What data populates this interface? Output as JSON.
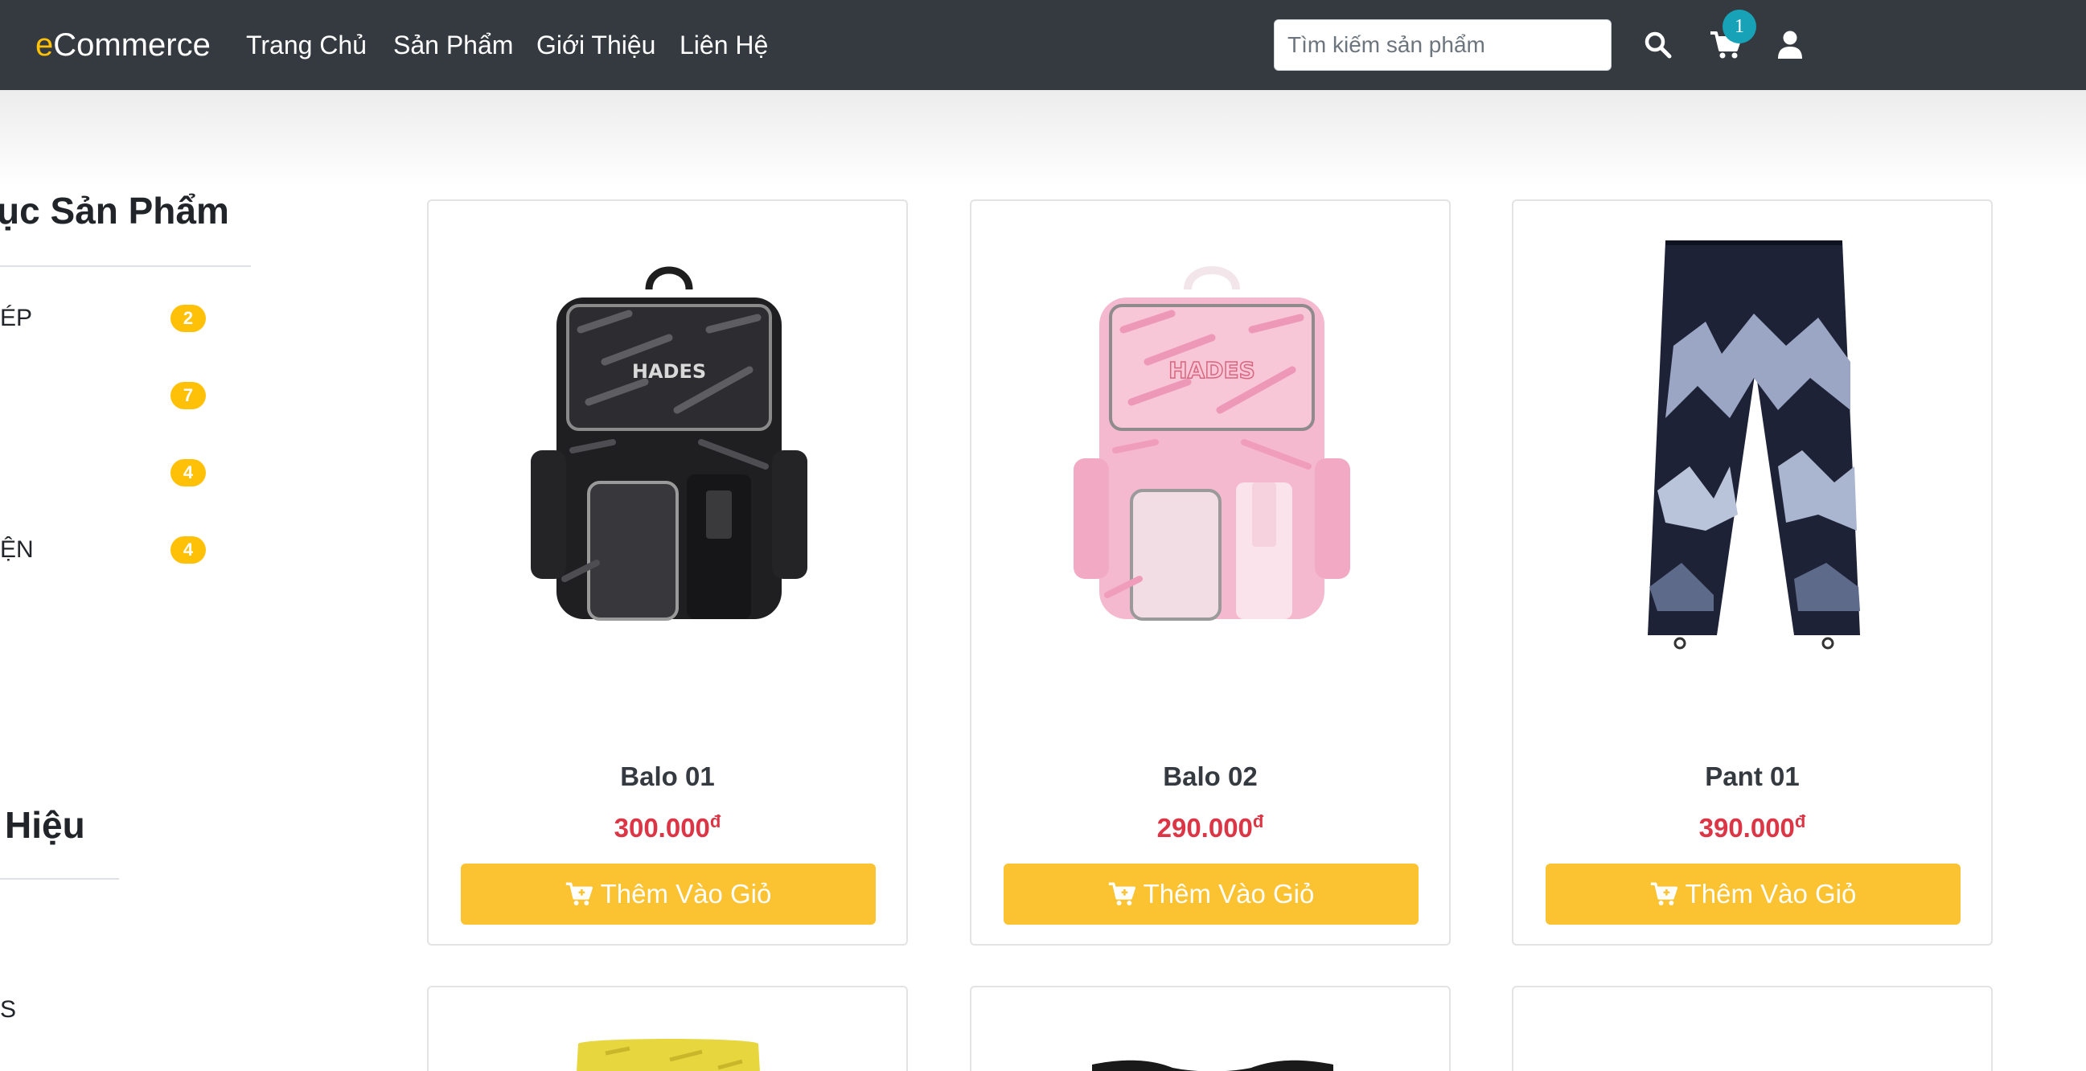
{
  "navbar": {
    "brand_accent": "e",
    "brand_rest": "Commerce",
    "links": [
      "Trang Chủ",
      "Sản Phẩm",
      "Giới Thiệu",
      "Liên Hệ"
    ],
    "search_placeholder": "Tìm kiếm sản phẩm",
    "cart_count": "1",
    "icons": [
      "search-icon",
      "cart-icon",
      "user-icon"
    ]
  },
  "sidebar": {
    "categories_title": "ục Sản Phẩm",
    "categories": [
      {
        "label": "ÉP",
        "count": "2"
      },
      {
        "label": "",
        "count": "7"
      },
      {
        "label": "",
        "count": "4"
      },
      {
        "label": "ỆN",
        "count": "4"
      }
    ],
    "brands_title": "Hiệu",
    "brand_items": [
      "S"
    ]
  },
  "products": [
    {
      "name": "Balo 01",
      "price": "300.000",
      "currency": "đ",
      "button": "Thêm Vào Giỏ"
    },
    {
      "name": "Balo 02",
      "price": "290.000",
      "currency": "đ",
      "button": "Thêm Vào Giỏ"
    },
    {
      "name": "Pant 01",
      "price": "390.000",
      "currency": "đ",
      "button": "Thêm Vào Giỏ"
    }
  ],
  "colors": {
    "navbar": "#343a40",
    "accent": "#ffc107",
    "price": "#dc3545",
    "badge": "#17a2b8",
    "button": "#fbc231"
  }
}
